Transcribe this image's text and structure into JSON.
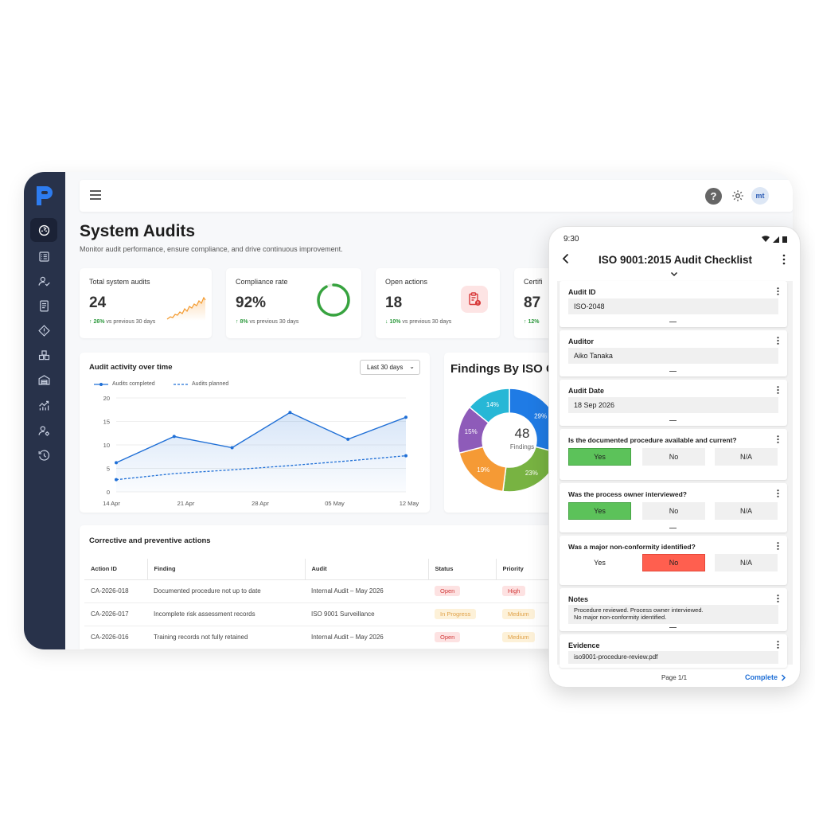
{
  "app": {
    "avatar_initials": "mt",
    "help_label": "?",
    "sidebar": [
      "dashboard-icon",
      "checklist-icon",
      "user-check-icon",
      "document-icon",
      "risk-icon",
      "supplier-icon",
      "warehouse-icon",
      "analytics-icon",
      "user-settings-icon",
      "history-icon"
    ],
    "accent": "#1f6fd6"
  },
  "page": {
    "title": "System Audits",
    "subtitle": "Monitor audit performance, ensure compliance, and drive continuous improvement."
  },
  "stats": [
    {
      "label": "Total system audits",
      "value": "24",
      "trend": "26%",
      "trend_suffix": "vs previous 30 days",
      "direction": "up"
    },
    {
      "label": "Compliance rate",
      "value": "92%",
      "trend": "8%",
      "trend_suffix": "vs previous 30 days",
      "direction": "up",
      "ring_fraction": 0.92
    },
    {
      "label": "Open actions",
      "value": "18",
      "trend": "10%",
      "trend_suffix": "vs previous 30 days",
      "direction": "down"
    },
    {
      "label": "Certifi",
      "value": "87",
      "trend": "12%",
      "direction": "up"
    }
  ],
  "activity": {
    "title": "Audit activity over time",
    "range_label": "Last 30 days",
    "legend_completed": "Audits completed",
    "legend_planned": "Audits planned"
  },
  "findings": {
    "title": "Findings By ISO C",
    "total": "48",
    "total_label": "Findings"
  },
  "actions": {
    "title": "Corrective and preventive actions",
    "columns": [
      "Action ID",
      "Finding",
      "Audit",
      "Status",
      "Priority"
    ],
    "rows": [
      {
        "id": "CA-2026-018",
        "finding": "Documented procedure not up to date",
        "audit": "Internal Audit – May 2026",
        "status": "Open",
        "priority": "High"
      },
      {
        "id": "CA-2026-017",
        "finding": "Incomplete risk assessment records",
        "audit": "ISO 9001 Surveillance",
        "status": "In Progress",
        "priority": "Medium"
      },
      {
        "id": "CA-2026-016",
        "finding": "Training records not fully retained",
        "audit": "Internal Audit – May 2026",
        "status": "Open",
        "priority": "Medium"
      }
    ]
  },
  "phone": {
    "time": "9:30",
    "title": "ISO 9001:2015 Audit Checklist",
    "audit_id_label": "Audit ID",
    "audit_id_value": "ISO-2048",
    "auditor_label": "Auditor",
    "auditor_value": "Aiko Tanaka",
    "audit_date_label": "Audit Date",
    "audit_date_value": "18 Sep 2026",
    "q1": "Is the documented procedure available and current?",
    "q2": "Was the process owner interviewed?",
    "q3": "Was a major non-conformity identified?",
    "opt_yes": "Yes",
    "opt_no": "No",
    "opt_na": "N/A",
    "q1_selected": "Yes",
    "q2_selected": "Yes",
    "q3_selected": "No",
    "notes_label": "Notes",
    "notes_line1": "Procedure reviewed. Process owner interviewed.",
    "notes_line2": "No major non-conformity identified.",
    "evidence_label": "Evidence",
    "evidence_value": "iso9001-procedure-review.pdf",
    "page_label": "Page 1/1",
    "complete_label": "Complete"
  },
  "chart_data": [
    {
      "type": "line",
      "title": "Audit activity over time",
      "x": [
        "14 Apr",
        "21 Apr",
        "28 Apr",
        "05 May",
        "12 May"
      ],
      "ylim": [
        0,
        20
      ],
      "yticks": [
        "20",
        "15",
        "10",
        "5",
        "0"
      ],
      "series": [
        {
          "name": "Audits completed",
          "color": "#1f6fd6",
          "style": "solid",
          "points": [
            [
              0,
              6.2
            ],
            [
              1,
              11.8
            ],
            [
              2,
              9.4
            ],
            [
              3,
              16.9
            ],
            [
              4,
              11.2
            ],
            [
              5,
              15.9
            ]
          ]
        },
        {
          "name": "Audits planned",
          "color": "#1f6fd6",
          "style": "dashed",
          "points": [
            [
              0,
              2.6
            ],
            [
              2,
              3.9
            ],
            [
              4,
              4.7
            ],
            [
              6,
              5.6
            ],
            [
              8,
              6.6
            ],
            [
              10,
              7.7
            ]
          ]
        }
      ],
      "legend": "top-left",
      "grid": true
    },
    {
      "type": "pie",
      "title": "Findings By ISO C",
      "total": "48",
      "slices": [
        {
          "label": "29%",
          "value": 29,
          "color": "#1f7be5"
        },
        {
          "label": "23%",
          "value": 23,
          "color": "#78b342"
        },
        {
          "label": "19%",
          "value": 19,
          "color": "#f59a35"
        },
        {
          "label": "15%",
          "value": 15,
          "color": "#8e5bb9"
        },
        {
          "label": "14%",
          "value": 14,
          "color": "#27b7d6"
        }
      ]
    }
  ]
}
